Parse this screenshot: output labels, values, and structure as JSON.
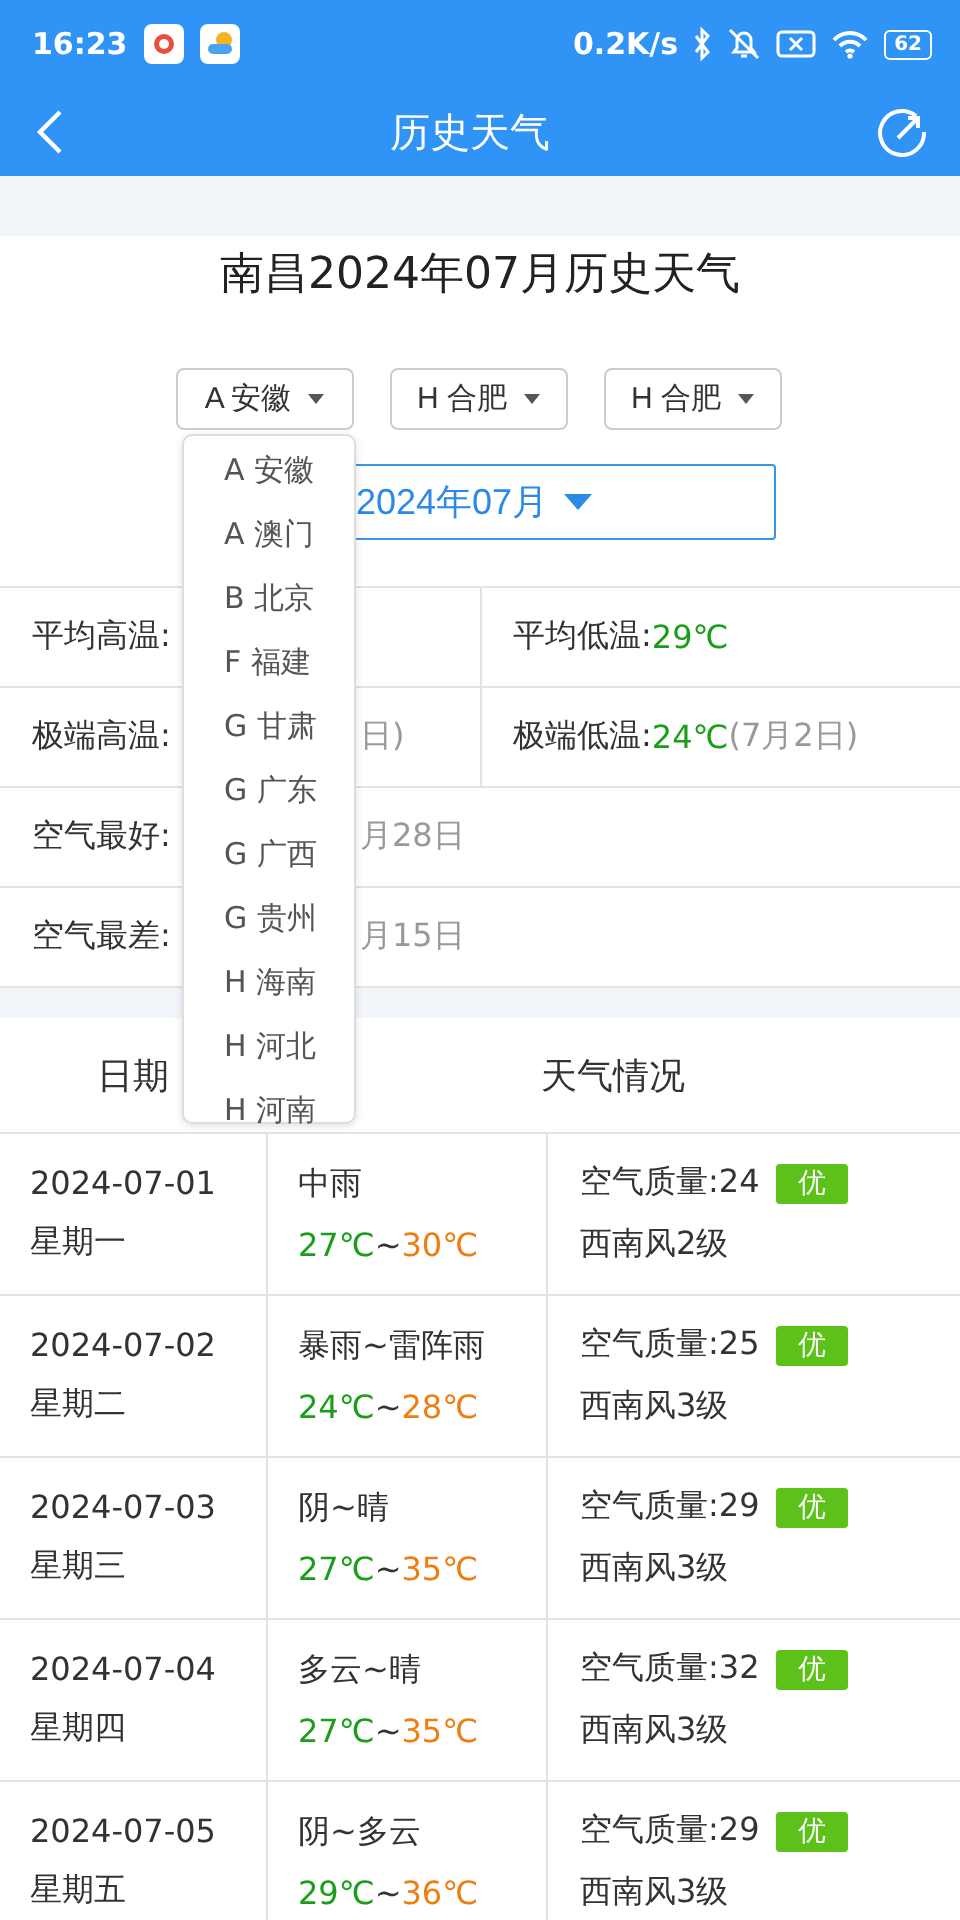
{
  "status_bar": {
    "time": "16:23",
    "net_speed": "0.2K/s",
    "battery": "62"
  },
  "app_bar": {
    "title": "历史天气"
  },
  "heading": "南昌2024年07月历史天气",
  "selects": [
    {
      "value": "A 安徽"
    },
    {
      "value": "H 合肥"
    },
    {
      "value": "H 合肥"
    }
  ],
  "month_select": {
    "value": "2024年07月"
  },
  "province_dropdown": {
    "items": [
      "A 安徽",
      "A 澳门",
      "B 北京",
      "F 福建",
      "G 甘肃",
      "G 广东",
      "G 广西",
      "G 贵州",
      "H 海南",
      "H 河北",
      "H 河南"
    ]
  },
  "stats": [
    {
      "cells": [
        {
          "label": "平均高温:"
        },
        {
          "label": "平均低温:",
          "value": "29℃"
        }
      ]
    },
    {
      "cells": [
        {
          "label": "极端高温:",
          "note": "日)"
        },
        {
          "label": "极端低温:",
          "value": "24℃",
          "note": "(7月2日)"
        }
      ]
    },
    {
      "cells": [
        {
          "label": "空气最好:",
          "note": "月28日"
        }
      ]
    },
    {
      "cells": [
        {
          "label": "空气最差:",
          "note": "月15日"
        }
      ]
    }
  ],
  "table": {
    "columns": [
      "日期",
      "天气情况"
    ],
    "rows": [
      {
        "date": "2024-07-01",
        "weekday": "星期一",
        "weather": "中雨",
        "low": "27℃",
        "sep": "~",
        "high": "30℃",
        "aqi": "空气质量:24",
        "grade": "优",
        "wind": "西南风2级"
      },
      {
        "date": "2024-07-02",
        "weekday": "星期二",
        "weather": "暴雨~雷阵雨",
        "low": "24℃",
        "sep": "~",
        "high": "28℃",
        "aqi": "空气质量:25",
        "grade": "优",
        "wind": "西南风3级"
      },
      {
        "date": "2024-07-03",
        "weekday": "星期三",
        "weather": "阴~晴",
        "low": "27℃",
        "sep": "~",
        "high": "35℃",
        "aqi": "空气质量:29",
        "grade": "优",
        "wind": "西南风3级"
      },
      {
        "date": "2024-07-04",
        "weekday": "星期四",
        "weather": "多云~晴",
        "low": "27℃",
        "sep": "~",
        "high": "35℃",
        "aqi": "空气质量:32",
        "grade": "优",
        "wind": "西南风3级"
      },
      {
        "date": "2024-07-05",
        "weekday": "星期五",
        "weather": "阴~多云",
        "low": "29℃",
        "sep": "~",
        "high": "36℃",
        "aqi": "空气质量:29",
        "grade": "优",
        "wind": "西南风3级"
      }
    ]
  }
}
